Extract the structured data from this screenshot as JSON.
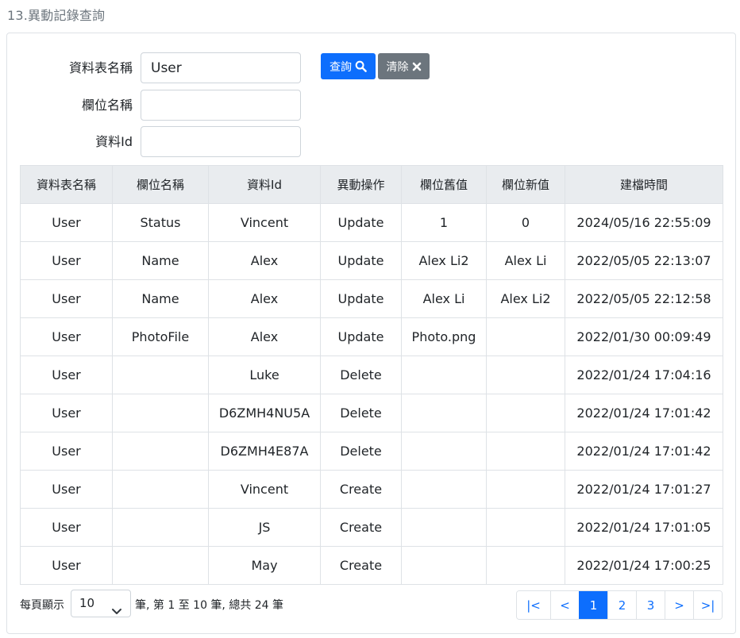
{
  "page": {
    "title": "13.異動記錄查詢"
  },
  "search": {
    "fields": [
      {
        "label": "資料表名稱",
        "value": "User"
      },
      {
        "label": "欄位名稱",
        "value": ""
      },
      {
        "label": "資料Id",
        "value": ""
      }
    ],
    "query_label": "查詢",
    "clear_label": "清除"
  },
  "table": {
    "headers": [
      "資料表名稱",
      "欄位名稱",
      "資料Id",
      "異動操作",
      "欄位舊值",
      "欄位新值",
      "建檔時間"
    ],
    "rows": [
      [
        "User",
        "Status",
        "Vincent",
        "Update",
        "1",
        "0",
        "2024/05/16 22:55:09"
      ],
      [
        "User",
        "Name",
        "Alex",
        "Update",
        "Alex Li2",
        "Alex Li",
        "2022/05/05 22:13:07"
      ],
      [
        "User",
        "Name",
        "Alex",
        "Update",
        "Alex Li",
        "Alex Li2",
        "2022/05/05 22:12:58"
      ],
      [
        "User",
        "PhotoFile",
        "Alex",
        "Update",
        "Photo.png",
        "",
        "2022/01/30 00:09:49"
      ],
      [
        "User",
        "",
        "Luke",
        "Delete",
        "",
        "",
        "2022/01/24 17:04:16"
      ],
      [
        "User",
        "",
        "D6ZMH4NU5A",
        "Delete",
        "",
        "",
        "2022/01/24 17:01:42"
      ],
      [
        "User",
        "",
        "D6ZMH4E87A",
        "Delete",
        "",
        "",
        "2022/01/24 17:01:42"
      ],
      [
        "User",
        "",
        "Vincent",
        "Create",
        "",
        "",
        "2022/01/24 17:01:27"
      ],
      [
        "User",
        "",
        "JS",
        "Create",
        "",
        "",
        "2022/01/24 17:01:05"
      ],
      [
        "User",
        "",
        "May",
        "Create",
        "",
        "",
        "2022/01/24 17:00:25"
      ]
    ]
  },
  "footer": {
    "per_page_label": "每頁顯示",
    "per_page_value": "10",
    "range_text": "筆, 第 1 至 10 筆, 總共 24 筆"
  },
  "pagination": {
    "first": "|<",
    "prev": "<",
    "pages": [
      "1",
      "2",
      "3"
    ],
    "active": "1",
    "next": ">",
    "last": ">|"
  },
  "colors": {
    "primary": "#0d6efd",
    "secondary": "#6c757d"
  },
  "icons": {
    "query": "search-icon",
    "clear": "close-icon",
    "select": "chevron-down-icon"
  }
}
